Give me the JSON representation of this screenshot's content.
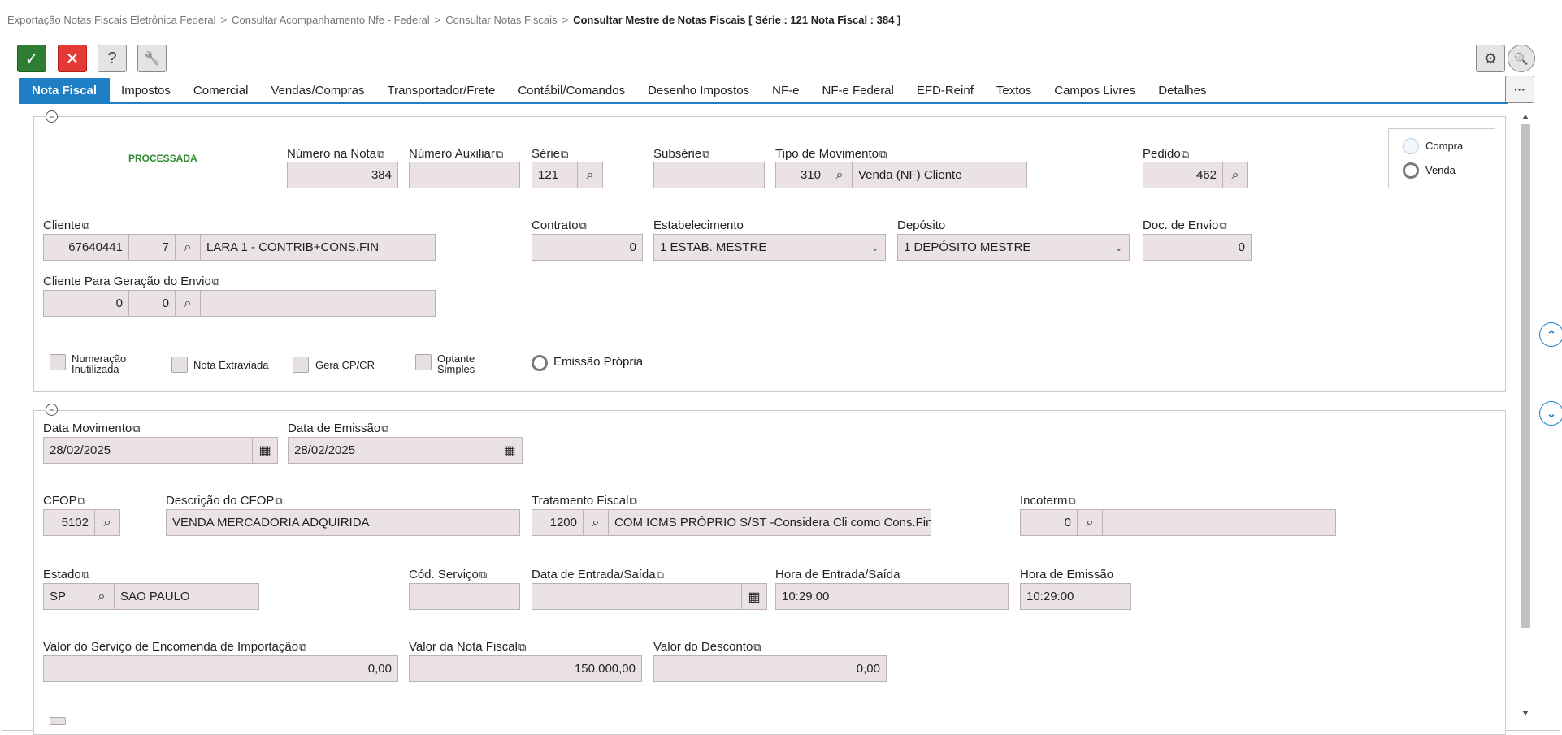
{
  "breadcrumb": {
    "items": [
      "Exportação Notas Fiscais Eletrônica Federal",
      "Consultar Acompanhamento Nfe - Federal",
      "Consultar Notas Fiscais"
    ],
    "current": "Consultar Mestre de Notas Fiscais [ Série : 121 Nota Fiscal : 384 ]",
    "separator": ">"
  },
  "toolbar": {
    "confirm_icon": "✓",
    "cancel_icon": "✕",
    "help_icon": "?",
    "tools_icon": "🔧",
    "gear_icon": "⚙",
    "search_icon": "🔍",
    "more_icon": "···"
  },
  "tabs": [
    "Nota Fiscal",
    "Impostos",
    "Comercial",
    "Vendas/Compras",
    "Transportador/Frete",
    "Contábil/Comandos",
    "Desenho Impostos",
    "NF-e",
    "NF-e Federal",
    "EFD-Reinf",
    "Textos",
    "Campos Livres",
    "Detalhes"
  ],
  "status": "PROCESSADA",
  "copy_icon": "⧉",
  "search_glyph": "⌕",
  "calendar_glyph": "▦",
  "fields": {
    "numero_nota": {
      "label": "Número na Nota",
      "value": "384"
    },
    "numero_auxiliar": {
      "label": "Número Auxiliar",
      "value": ""
    },
    "serie": {
      "label": "Série",
      "value": "121"
    },
    "subserie": {
      "label": "Subsérie",
      "value": ""
    },
    "tipo_movimento": {
      "label": "Tipo de Movimento",
      "code": "310",
      "desc": "Venda (NF) Cliente"
    },
    "pedido": {
      "label": "Pedido",
      "value": "462"
    },
    "cliente": {
      "label": "Cliente",
      "code": "67640441",
      "sub": "7",
      "desc": "LARA 1 - CONTRIB+CONS.FIN"
    },
    "contrato": {
      "label": "Contrato",
      "value": "0"
    },
    "estabelecimento": {
      "label": "Estabelecimento",
      "value": "1 ESTAB. MESTRE"
    },
    "deposito": {
      "label": "Depósito",
      "value": "1 DEPÓSITO MESTRE"
    },
    "doc_envio": {
      "label": "Doc. de Envio",
      "value": "0"
    },
    "cliente_envio": {
      "label": "Cliente Para Geração do Envio",
      "code": "0",
      "sub": "0",
      "desc": ""
    },
    "data_movimento": {
      "label": "Data Movimento",
      "value": "28/02/2025"
    },
    "data_emissao": {
      "label": "Data de Emissão",
      "value": "28/02/2025"
    },
    "cfop": {
      "label": "CFOP",
      "value": "5102"
    },
    "descricao_cfop": {
      "label": "Descrição do CFOP",
      "value": "VENDA MERCADORIA ADQUIRIDA"
    },
    "tratamento_fiscal": {
      "label": "Tratamento Fiscal",
      "code": "1200",
      "desc": "COM ICMS PRÓPRIO S/ST -Considera Cli como Cons.Fin"
    },
    "incoterm": {
      "label": "Incoterm",
      "code": "0",
      "desc": ""
    },
    "estado": {
      "label": "Estado",
      "code": "SP",
      "desc": "SAO PAULO"
    },
    "cod_servico": {
      "label": "Cód. Serviço",
      "value": ""
    },
    "data_entrada_saida": {
      "label": "Data de Entrada/Saída",
      "value": ""
    },
    "hora_entrada_saida": {
      "label": "Hora de Entrada/Saída",
      "value": "10:29:00"
    },
    "hora_emissao": {
      "label": "Hora de Emissão",
      "value": "10:29:00"
    },
    "valor_servico_importacao": {
      "label": "Valor do Serviço de Encomenda de Importação",
      "value": "0,00"
    },
    "valor_nota": {
      "label": "Valor da Nota Fiscal",
      "value": "150.000,00"
    },
    "valor_desconto": {
      "label": "Valor do Desconto",
      "value": "0,00"
    }
  },
  "checkboxes": {
    "numeracao_inutilizada": [
      "Numeração",
      "Inutilizada"
    ],
    "nota_extraviada": "Nota Extraviada",
    "gera_cp_cr": "Gera CP/CR",
    "optante_simples": [
      "Optante",
      "Simples"
    ]
  },
  "emissao_propria": "Emissão Própria",
  "tipo_operacao": {
    "compra": "Compra",
    "venda": "Venda"
  },
  "colors": {
    "accent": "#1f7fc5",
    "confirm": "#2e7d32",
    "cancel": "#e53935",
    "status": "#2e8b2e",
    "field_bg": "#ebe3e3"
  }
}
